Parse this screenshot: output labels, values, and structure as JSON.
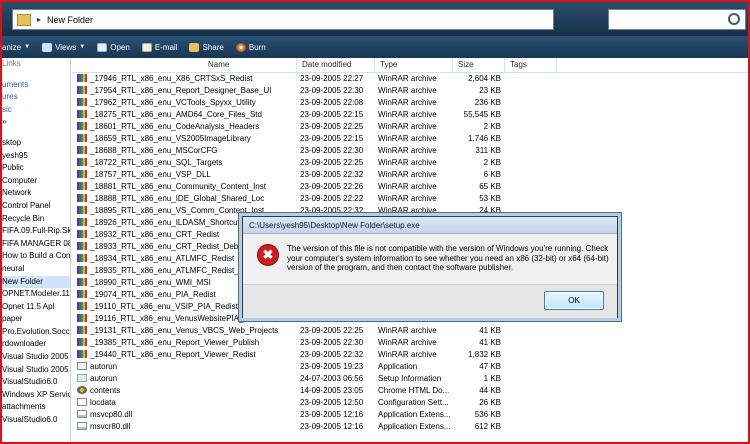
{
  "address": {
    "crumb": "New Folder"
  },
  "toolbar": {
    "items": [
      {
        "label": "anize",
        "icon": "organize-icon",
        "dropdown": true
      },
      {
        "label": "Views",
        "icon": "views-icon",
        "dropdown": true
      },
      {
        "label": "Open",
        "icon": "open-icon",
        "dropdown": false
      },
      {
        "label": "E-mail",
        "icon": "email-icon",
        "dropdown": false
      },
      {
        "label": "Share",
        "icon": "share-icon",
        "dropdown": false
      },
      {
        "label": "Burn",
        "icon": "burn-icon",
        "dropdown": false
      }
    ]
  },
  "sidebar": {
    "top": [
      "Links",
      "uments",
      "ures",
      "sic",
      "»"
    ],
    "tree": [
      "sktop",
      "yesh95",
      "Public",
      "Computer",
      "Network",
      "Control Panel",
      "Recycle Bin",
      "FIFA.09.Full-Rip.Sku",
      "FIFA MANAGER 08",
      "How to Build a Com",
      "neural",
      "New Folder",
      "OPNET.Modeler.11.",
      "Opnet 11.5 Apl",
      "paper",
      "Pro.Evolution.Socce",
      "rdownloader",
      "Visual Studio 2005 S",
      "Visual Studio 2005 S",
      "VisualStudio6.0",
      "Windows XP Service",
      "attachments",
      "VisualStudio6.0"
    ],
    "selected": "New Folder"
  },
  "columns": {
    "name": "Name",
    "date": "Date modified",
    "type": "Type",
    "size": "Size",
    "tags": "Tags"
  },
  "files": [
    {
      "name": "_17946_RTL_x86_enu_X86_CRTSxS_Redist",
      "date": "23-09-2005 22:27",
      "type": "WinRAR archive",
      "size": "2,604 KB",
      "icon": "rar"
    },
    {
      "name": "_17954_RTL_x86_enu_Report_Designer_Base_UI",
      "date": "23-09-2005 22:30",
      "type": "WinRAR archive",
      "size": "23 KB",
      "icon": "rar"
    },
    {
      "name": "_17962_RTL_x86_enu_VCTools_Spyxx_Utility",
      "date": "23-09-2005 22:08",
      "type": "WinRAR archive",
      "size": "236 KB",
      "icon": "rar"
    },
    {
      "name": "_18275_RTL_x86_enu_AMD64_Core_Files_Std",
      "date": "23-09-2005 22:15",
      "type": "WinRAR archive",
      "size": "55,545 KB",
      "icon": "rar"
    },
    {
      "name": "_18601_RTL_x86_enu_CodeAnalysis_Headers",
      "date": "23-09-2005 22:25",
      "type": "WinRAR archive",
      "size": "2 KB",
      "icon": "rar"
    },
    {
      "name": "_18659_RTL_x86_enu_VS2005ImageLibrary",
      "date": "23-09-2005 22:15",
      "type": "WinRAR archive",
      "size": "1,746 KB",
      "icon": "rar"
    },
    {
      "name": "_18688_RTL_x86_enu_MSCorCFG",
      "date": "23-09-2005 22:30",
      "type": "WinRAR archive",
      "size": "311 KB",
      "icon": "rar"
    },
    {
      "name": "_18722_RTL_x86_enu_SQL_Targets",
      "date": "23-09-2005 22:25",
      "type": "WinRAR archive",
      "size": "2 KB",
      "icon": "rar"
    },
    {
      "name": "_18757_RTL_x86_enu_VSP_DLL",
      "date": "23-09-2005 22:32",
      "type": "WinRAR archive",
      "size": "6 KB",
      "icon": "rar"
    },
    {
      "name": "_18881_RTL_x86_enu_Community_Content_Inst",
      "date": "23-09-2005 22:26",
      "type": "WinRAR archive",
      "size": "65 KB",
      "icon": "rar"
    },
    {
      "name": "_18888_RTL_x86_enu_IDE_Global_Shared_Loc",
      "date": "23-09-2005 22:22",
      "type": "WinRAR archive",
      "size": "53 KB",
      "icon": "rar"
    },
    {
      "name": "_18895_RTL_x86_enu_VS_Comm_Content_Inst",
      "date": "23-09-2005 22:32",
      "type": "WinRAR archive",
      "size": "24 KB",
      "icon": "rar"
    },
    {
      "name": "_18926_RTL_x86_enu_ILDASM_Shortcut",
      "date": "",
      "type": "",
      "size": "",
      "icon": "rar"
    },
    {
      "name": "_18932_RTL_x86_enu_CRT_Redist",
      "date": "",
      "type": "",
      "size": "",
      "icon": "rar"
    },
    {
      "name": "_18933_RTL_x86_enu_CRT_Redist_Debug",
      "date": "",
      "type": "",
      "size": "",
      "icon": "rar"
    },
    {
      "name": "_18934_RTL_x86_enu_ATLMFC_Redist",
      "date": "",
      "type": "",
      "size": "",
      "icon": "rar"
    },
    {
      "name": "_18935_RTL_x86_enu_ATLMFC_Redist_Debug",
      "date": "",
      "type": "",
      "size": "",
      "icon": "rar"
    },
    {
      "name": "_18990_RTL_x86_enu_WMI_MSI",
      "date": "",
      "type": "",
      "size": "",
      "icon": "rar"
    },
    {
      "name": "_19074_RTL_x86_enu_PIA_Redist",
      "date": "",
      "type": "",
      "size": "",
      "icon": "rar"
    },
    {
      "name": "_19110_RTL_x86_enu_VSIP_PIA_Redist_80",
      "date": "",
      "type": "",
      "size": "",
      "icon": "rar"
    },
    {
      "name": "_19116_RTL_x86_enu_VenusWebsitePIA_GAC",
      "date": "23-09-2005 22:08",
      "type": "WinRAR archive",
      "size": "13 KB",
      "icon": "rar"
    },
    {
      "name": "_19131_RTL_x86_enu_Venus_VBCS_Web_Projects",
      "date": "23-09-2005 22:25",
      "type": "WinRAR archive",
      "size": "41 KB",
      "icon": "rar"
    },
    {
      "name": "_19385_RTL_x86_enu_Report_Viewer_Publish",
      "date": "23-09-2005 22:30",
      "type": "WinRAR archive",
      "size": "41 KB",
      "icon": "rar"
    },
    {
      "name": "_19440_RTL_x86_enu_Report_Viewer_Redist",
      "date": "23-09-2005 22:32",
      "type": "WinRAR archive",
      "size": "1,832 KB",
      "icon": "rar"
    },
    {
      "name": "autorun",
      "date": "23-09-2005 19:23",
      "type": "Application",
      "size": "47 KB",
      "icon": "app"
    },
    {
      "name": "autorun",
      "date": "24-07-2003 06:56",
      "type": "Setup Information",
      "size": "1 KB",
      "icon": "setup"
    },
    {
      "name": "contents",
      "date": "14-09-2005 23:05",
      "type": "Chrome HTML Do...",
      "size": "44 KB",
      "icon": "chm"
    },
    {
      "name": "locdata",
      "date": "23-09-2005 12:50",
      "type": "Configuration Sett...",
      "size": "26 KB",
      "icon": "cfg"
    },
    {
      "name": "msvcp80.dll",
      "date": "23-09-2005 12:16",
      "type": "Application Extens...",
      "size": "536 KB",
      "icon": "dll"
    },
    {
      "name": "msvcr80.dll",
      "date": "23-09-2005 12:16",
      "type": "Application Extens...",
      "size": "612 KB",
      "icon": "dll"
    }
  ],
  "dialog": {
    "title": "C:\\Users\\yesh95\\Desktop\\New Folder\\setup.exe",
    "message": "The version of this file is not compatible with the version of Windows you're running. Check your computer's system information to see whether you need an x86 (32-bit) or x64 (64-bit) version of the program, and then contact the software publisher.",
    "icon_glyph": "✖",
    "ok_label": "OK"
  },
  "colors": {
    "frame": "#d6121b",
    "toolbar": "#1f4566",
    "accent": "#2563b0",
    "error": "#d01c1c"
  }
}
